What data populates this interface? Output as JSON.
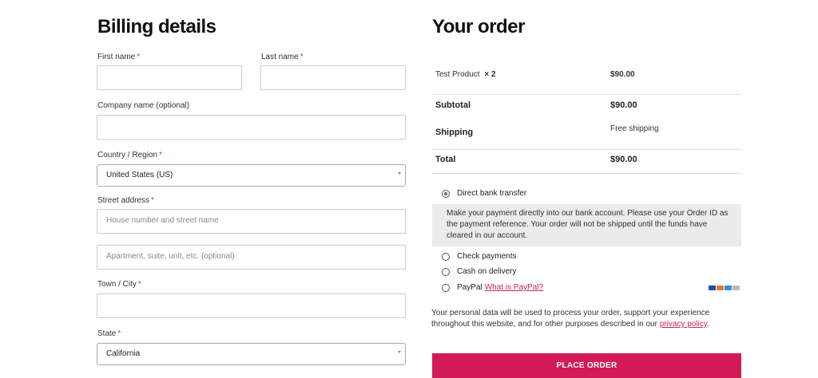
{
  "billing": {
    "heading": "Billing details",
    "first_name": {
      "label": "First name",
      "required": "*"
    },
    "last_name": {
      "label": "Last name",
      "required": "*"
    },
    "company": {
      "label": "Company name (optional)"
    },
    "country": {
      "label": "Country / Region",
      "required": "*",
      "value": "United States (US)"
    },
    "street": {
      "label": "Street address",
      "required": "*",
      "placeholder1": "House number and street name",
      "placeholder2": "Apartment, suite, unit, etc. (optional)"
    },
    "city": {
      "label": "Town / City",
      "required": "*"
    },
    "state": {
      "label": "State",
      "required": "*",
      "value": "California"
    }
  },
  "order": {
    "heading": "Your order",
    "product_name": "Test Product",
    "product_qty": "× 2",
    "product_price": "$90.00",
    "subtotal_label": "Subtotal",
    "subtotal_value": "$90.00",
    "shipping_label": "Shipping",
    "shipping_value": "Free shipping",
    "total_label": "Total",
    "total_value": "$90.00"
  },
  "payment": {
    "methods": [
      {
        "label": "Direct bank transfer",
        "selected": true
      },
      {
        "label": "Check payments",
        "selected": false
      },
      {
        "label": "Cash on delivery",
        "selected": false
      },
      {
        "label": "PayPal",
        "selected": false,
        "link": "What is PayPal?"
      }
    ],
    "bank_description": "Make your payment directly into our bank account. Please use your Order ID as the payment reference. Your order will not be shipped until the funds have cleared in our account."
  },
  "privacy": {
    "text": "Your personal data will be used to process your order, support your experience throughout this website, and for other purposes described in our",
    "link": "privacy policy",
    "end": "."
  },
  "place_order_label": "PLACE ORDER",
  "colors": {
    "accent": "#d21b54",
    "link": "#c9244f"
  },
  "icons": {
    "card_logos": "payment-cards-icon"
  }
}
